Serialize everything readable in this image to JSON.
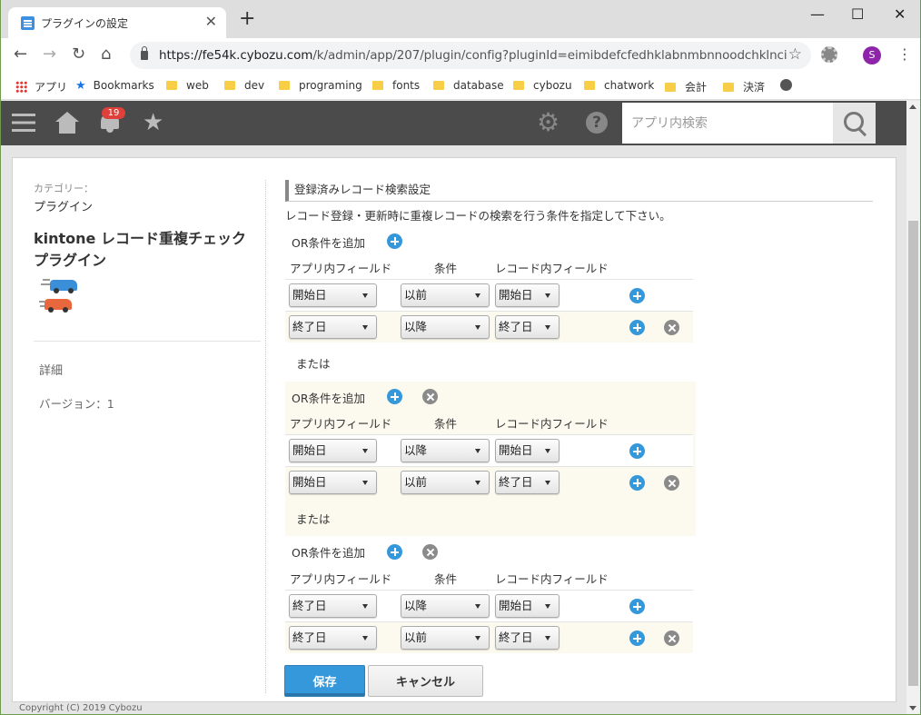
{
  "browser": {
    "tab_title": "プラグインの設定",
    "url_host": "https://fe54k.cybozu.com",
    "url_path": "/k/admin/app/207/plugin/config?pluginId=eimibdefcfedhklabnmbnnoodchklnci",
    "profile_initial": "S"
  },
  "bookmarks": [
    "アプリ",
    "Bookmarks",
    "web",
    "dev",
    "programing",
    "fonts",
    "database",
    "cybozu",
    "chatwork",
    "会計",
    "決済"
  ],
  "header": {
    "notification_count": "19",
    "search_placeholder": "アプリ内検索"
  },
  "sidebar": {
    "category_label": "カテゴリー：",
    "category_value": "プラグイン",
    "plugin_name": "kintone レコード重複チェックプラグイン",
    "details_link": "詳細",
    "version": "バージョン：1"
  },
  "settings": {
    "section_title": "登録済みレコード検索設定",
    "description": "レコード登録・更新時に重複レコードの検索を行う条件を指定して下さい。",
    "or_add_label": "OR条件を追加",
    "or_separator": "または",
    "columns": [
      "アプリ内フィールド",
      "条件",
      "レコード内フィールド"
    ],
    "groups": [
      {
        "rows": [
          {
            "field": "開始日",
            "condition": "以前",
            "record_field": "開始日"
          },
          {
            "field": "終了日",
            "condition": "以降",
            "record_field": "終了日"
          }
        ]
      },
      {
        "rows": [
          {
            "field": "開始日",
            "condition": "以降",
            "record_field": "開始日"
          },
          {
            "field": "開始日",
            "condition": "以前",
            "record_field": "終了日"
          }
        ]
      },
      {
        "rows": [
          {
            "field": "終了日",
            "condition": "以降",
            "record_field": "開始日"
          },
          {
            "field": "終了日",
            "condition": "以前",
            "record_field": "終了日"
          }
        ]
      }
    ]
  },
  "actions": {
    "save_label": "保存",
    "cancel_label": "キャンセル"
  },
  "footer": "Copyright (C) 2019 Cybozu"
}
